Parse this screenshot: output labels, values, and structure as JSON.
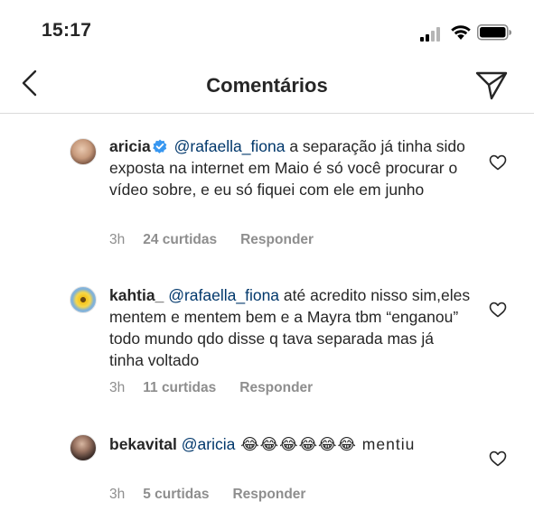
{
  "status": {
    "time": "15:17",
    "signal_icon": "cellular-signal-icon",
    "wifi_icon": "wifi-icon",
    "battery_icon": "battery-icon"
  },
  "nav": {
    "title": "Comentários",
    "back_icon": "chevron-left-icon",
    "share_icon": "send-icon"
  },
  "comments": [
    {
      "username": "aricia",
      "verified": true,
      "mention": "@rafaella_fiona",
      "text": " a separação já tinha sido exposta na internet em Maio é só você procurar o vídeo sobre, e eu só fiquei com ele em junho",
      "time": "3h",
      "likes": "24 curtidas",
      "reply": "Responder"
    },
    {
      "username": "kahtia_",
      "verified": false,
      "mention": "@rafaella_fiona",
      "text": " até acredito nisso sim,eles mentem e mentem bem e a Mayra tbm “enganou” todo mundo qdo disse q tava separada mas já tinha voltado",
      "time": "3h",
      "likes": "11 curtidas",
      "reply": "Responder"
    },
    {
      "username": "bekavital",
      "verified": false,
      "mention": "@aricia",
      "text": " 😂😂😂😂😂😂 mentiu",
      "time": "3h",
      "likes": "5 curtidas",
      "reply": "Responder"
    }
  ],
  "colors": {
    "mention": "#00376b",
    "meta": "#8e8e8e",
    "verified": "#3897f0",
    "text": "#262626"
  }
}
